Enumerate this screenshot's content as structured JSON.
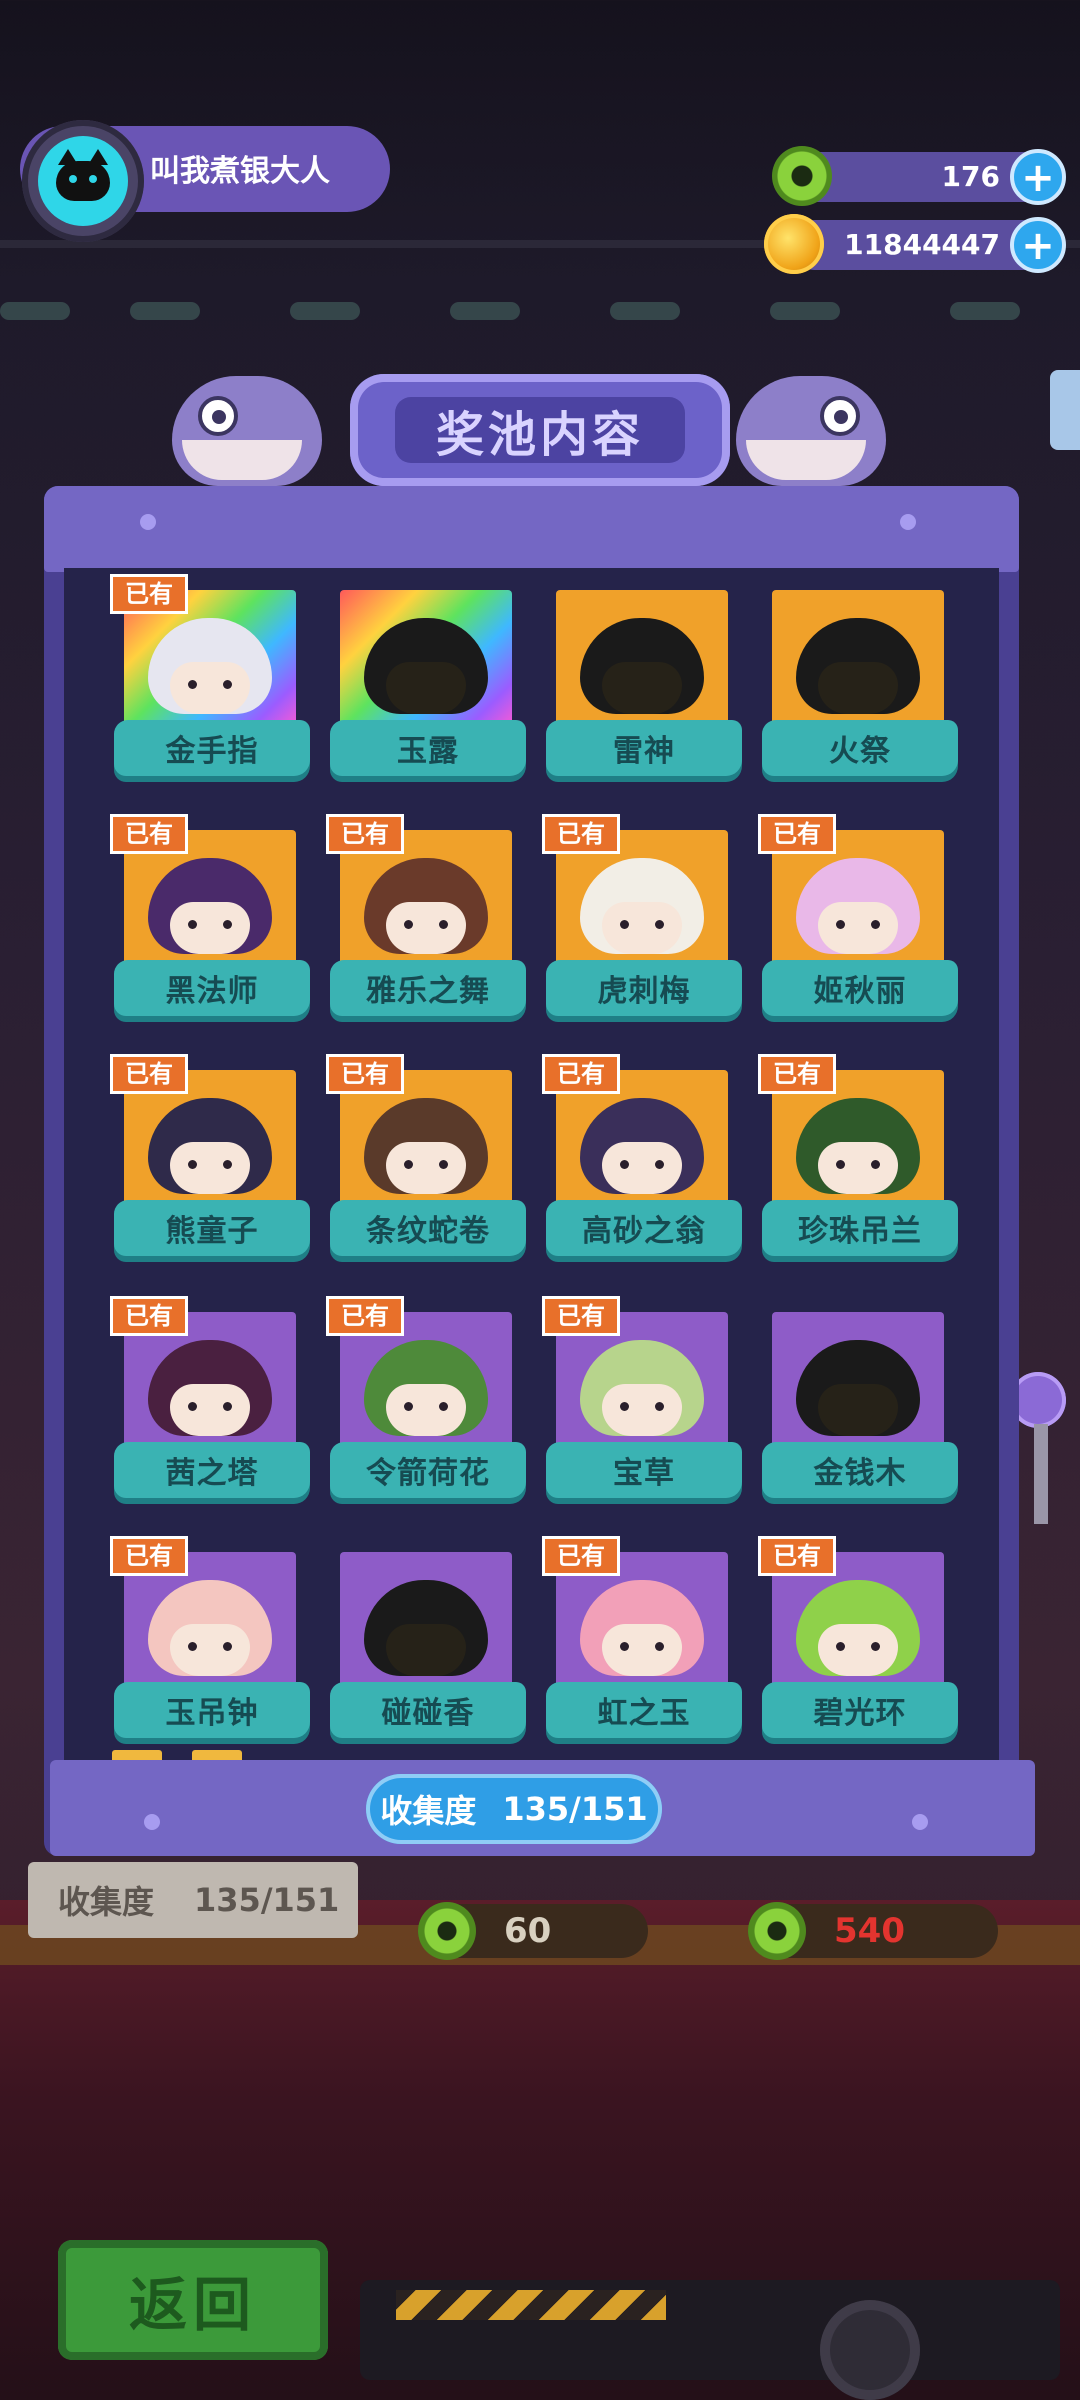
{
  "header": {
    "player_name": "叫我煮银大人",
    "currencies": [
      {
        "icon": "donut-coin-icon",
        "value": "176"
      },
      {
        "icon": "planet-coin-icon",
        "value": "11844447"
      }
    ]
  },
  "panel": {
    "title": "奖池内容",
    "progress_label": "收集度",
    "progress_value": "135/151"
  },
  "owned_label": "已有",
  "cards": [
    {
      "name": "金手指",
      "owned": true,
      "bg": "rainbow",
      "hair": "#e6e6f0"
    },
    {
      "name": "玉露",
      "owned": false,
      "bg": "rainbow",
      "hair": "#1a1a1a"
    },
    {
      "name": "雷神",
      "owned": false,
      "bg": "orange",
      "hair": "#1a1a1a"
    },
    {
      "name": "火祭",
      "owned": false,
      "bg": "orange",
      "hair": "#1a1a1a"
    },
    {
      "name": "黑法师",
      "owned": true,
      "bg": "orange",
      "hair": "#4a2a6a"
    },
    {
      "name": "雅乐之舞",
      "owned": true,
      "bg": "orange",
      "hair": "#6a3a2a"
    },
    {
      "name": "虎刺梅",
      "owned": true,
      "bg": "orange",
      "hair": "#f2eee6"
    },
    {
      "name": "姬秋丽",
      "owned": true,
      "bg": "orange",
      "hair": "#e9b8e8"
    },
    {
      "name": "熊童子",
      "owned": true,
      "bg": "orange",
      "hair": "#2f2a4a"
    },
    {
      "name": "条纹蛇卷",
      "owned": true,
      "bg": "orange",
      "hair": "#5a3a2a"
    },
    {
      "name": "高砂之翁",
      "owned": true,
      "bg": "orange",
      "hair": "#3a2f5a"
    },
    {
      "name": "珍珠吊兰",
      "owned": true,
      "bg": "orange",
      "hair": "#2f5a2a"
    },
    {
      "name": "茜之塔",
      "owned": true,
      "bg": "purple",
      "hair": "#4a2040"
    },
    {
      "name": "令箭荷花",
      "owned": true,
      "bg": "purple",
      "hair": "#4e8a3a"
    },
    {
      "name": "宝草",
      "owned": true,
      "bg": "purple",
      "hair": "#b7d48c"
    },
    {
      "name": "金钱木",
      "owned": false,
      "bg": "purple",
      "hair": "#1a1a1a"
    },
    {
      "name": "玉吊钟",
      "owned": true,
      "bg": "purple",
      "hair": "#f4c6c0"
    },
    {
      "name": "碰碰香",
      "owned": false,
      "bg": "purple",
      "hair": "#1a1a1a"
    },
    {
      "name": "虹之玉",
      "owned": true,
      "bg": "purple",
      "hair": "#f2a0b8"
    },
    {
      "name": "碧光环",
      "owned": true,
      "bg": "purple",
      "hair": "#8fd14a"
    }
  ],
  "background": {
    "collection_label": "收集度",
    "collection_value": "135/151",
    "price_1": "60",
    "price_2": "540"
  },
  "footer": {
    "back_label": "返回"
  },
  "colors": {
    "accent_teal": "#3ab3b3",
    "owned_badge": "#e8702a",
    "panel": "#4a4092"
  }
}
